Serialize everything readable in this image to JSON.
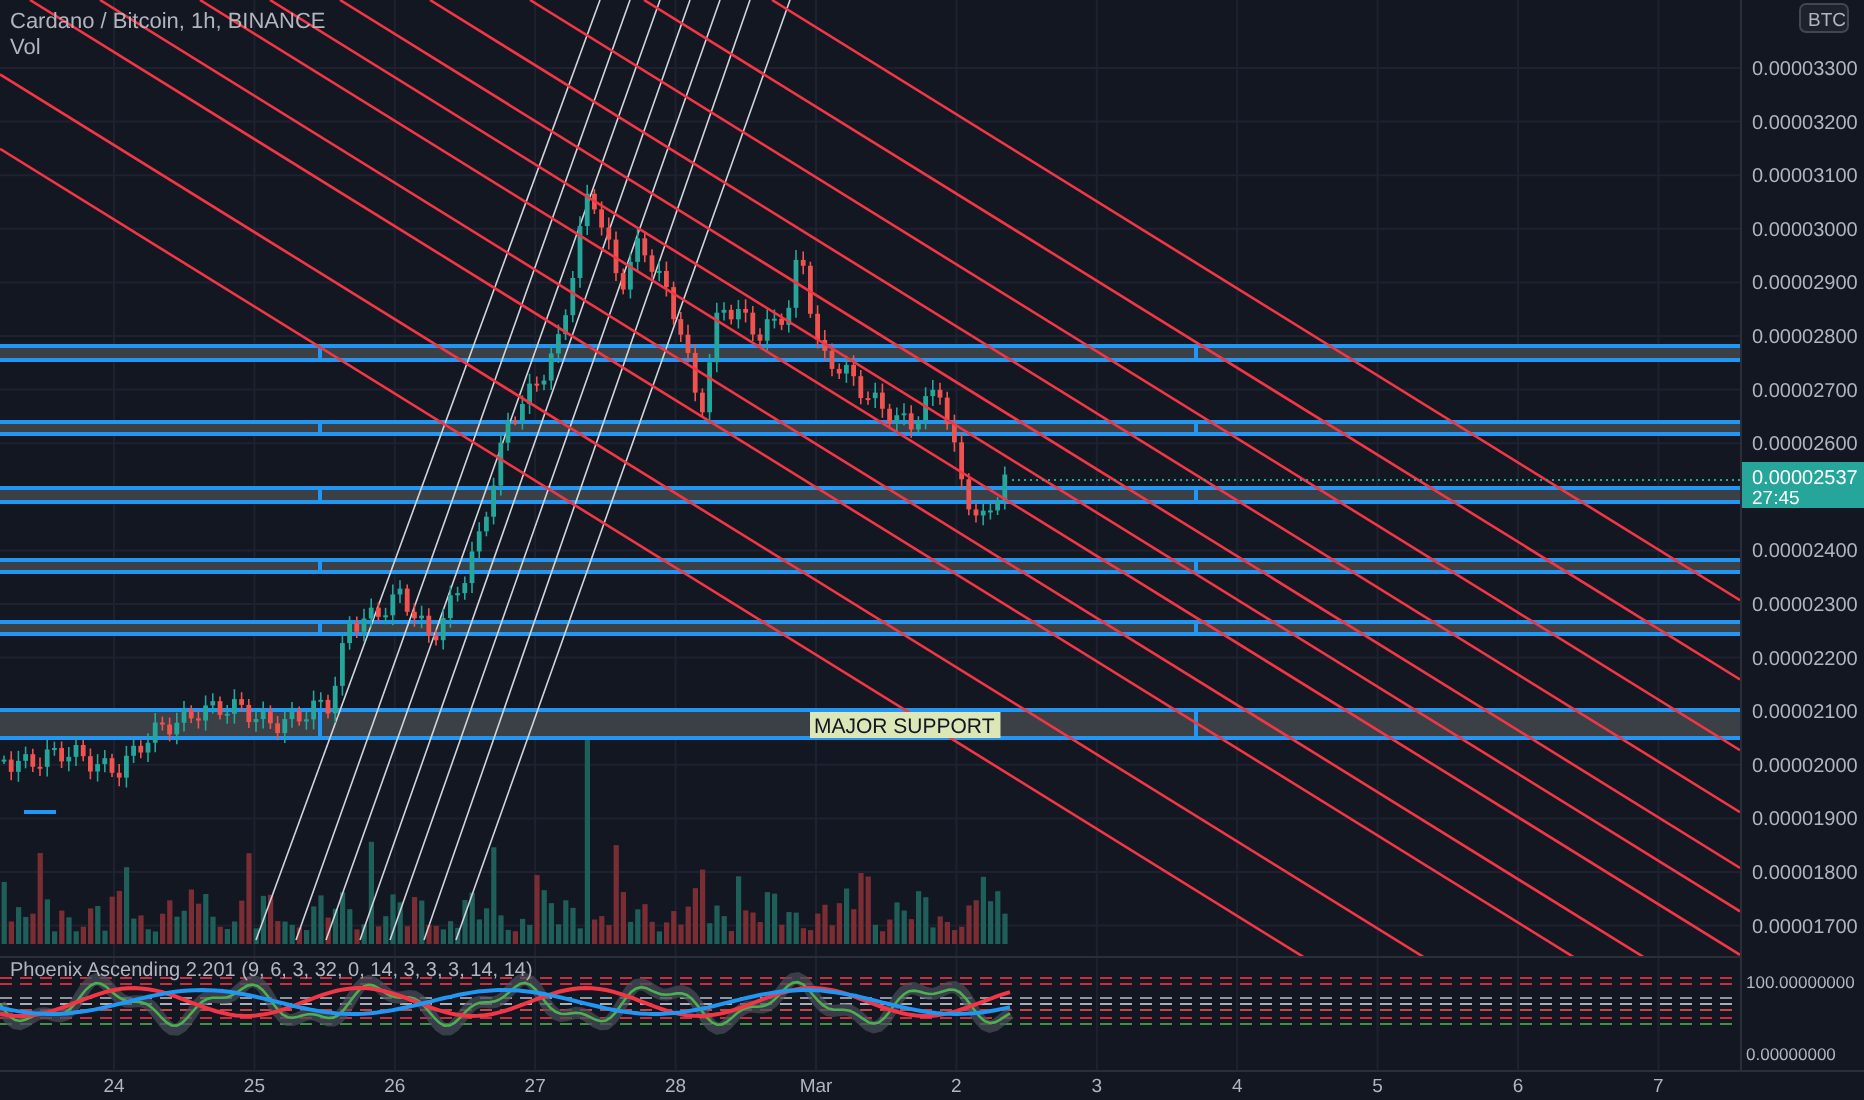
{
  "legend": {
    "symbol": "Cardano / Bitcoin, 1h, BINANCE",
    "volume": "Vol"
  },
  "price_axis": {
    "currency": "BTC",
    "labels": [
      "0.00003300",
      "0.00003200",
      "0.00003100",
      "0.00003000",
      "0.00002900",
      "0.00002800",
      "0.00002700",
      "0.00002600",
      "0.00002400",
      "0.00002300",
      "0.00002200",
      "0.00002100",
      "0.00002000",
      "0.00001900",
      "0.00001800",
      "0.00001700"
    ],
    "current_price": "0.00002537",
    "countdown": "27:45"
  },
  "zone_label": "MAJOR SUPPORT",
  "indicator": {
    "title": "Phoenix Ascending 2.201 (9, 6, 3, 32, 0, 14, 3, 3, 3, 14, 14)",
    "axis_labels": [
      "100.00000000",
      "0.00000000"
    ]
  },
  "time_axis": [
    "24",
    "25",
    "26",
    "27",
    "28",
    "Mar",
    "2",
    "3",
    "4",
    "5",
    "6",
    "7"
  ]
}
